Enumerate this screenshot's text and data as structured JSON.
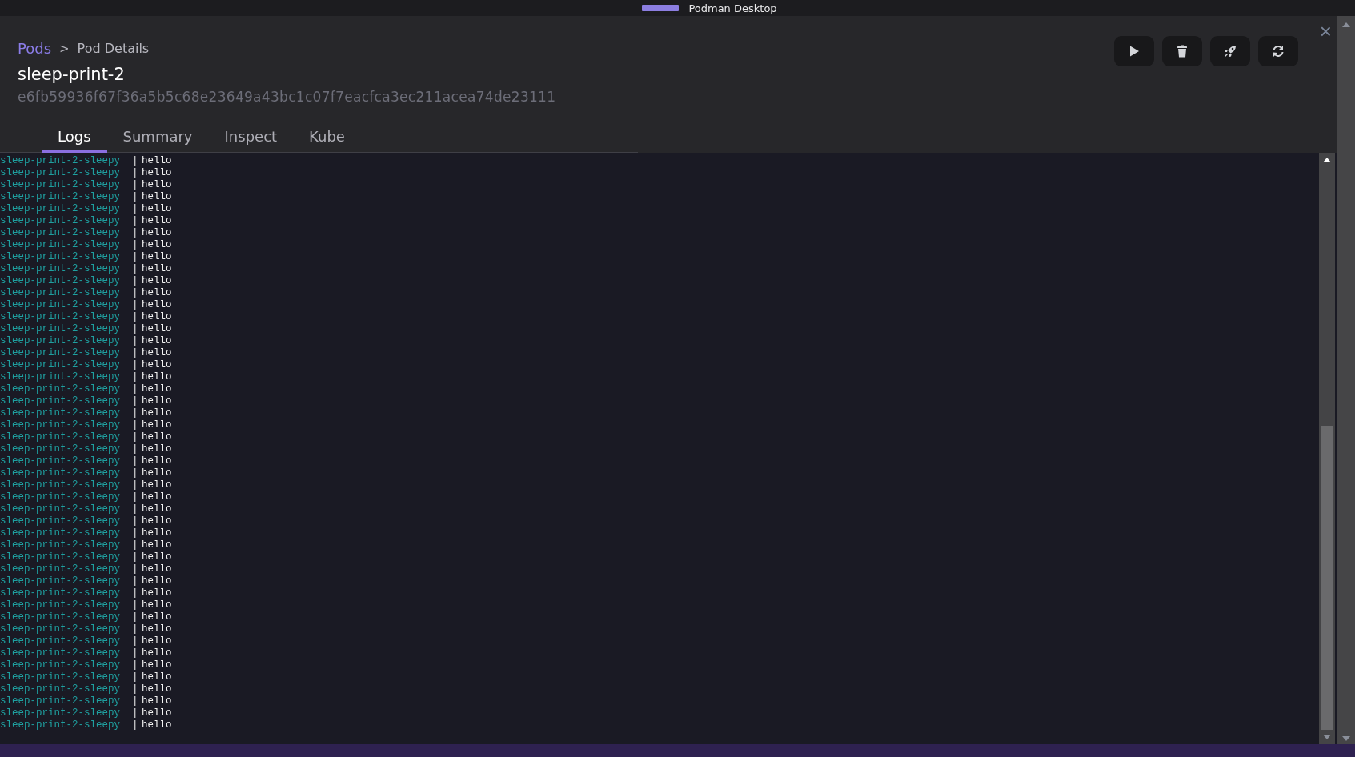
{
  "window": {
    "title": "Podman Desktop"
  },
  "breadcrumb": {
    "parent": "Pods",
    "separator": ">",
    "current": "Pod Details"
  },
  "pod": {
    "name": "sleep-print-2",
    "id": "e6fb59936f67f36a5b5c68e23649a43bc1c07f7eacfca3ec211acea74de23111"
  },
  "actions": [
    {
      "kind": "play"
    },
    {
      "kind": "delete"
    },
    {
      "kind": "deploy"
    },
    {
      "kind": "restart"
    }
  ],
  "close": "×",
  "tabs": [
    {
      "label": "Logs",
      "selected": true
    },
    {
      "label": "Summary",
      "selected": false
    },
    {
      "label": "Inspect",
      "selected": false
    },
    {
      "label": "Kube",
      "selected": false
    }
  ],
  "logs": [
    {
      "container": "sleep-print-2-sleepy",
      "separator": "|",
      "message": "hello"
    },
    {
      "container": "sleep-print-2-sleepy",
      "separator": "|",
      "message": "hello"
    },
    {
      "container": "sleep-print-2-sleepy",
      "separator": "|",
      "message": "hello"
    },
    {
      "container": "sleep-print-2-sleepy",
      "separator": "|",
      "message": "hello"
    },
    {
      "container": "sleep-print-2-sleepy",
      "separator": "|",
      "message": "hello"
    },
    {
      "container": "sleep-print-2-sleepy",
      "separator": "|",
      "message": "hello"
    },
    {
      "container": "sleep-print-2-sleepy",
      "separator": "|",
      "message": "hello"
    },
    {
      "container": "sleep-print-2-sleepy",
      "separator": "|",
      "message": "hello"
    },
    {
      "container": "sleep-print-2-sleepy",
      "separator": "|",
      "message": "hello"
    },
    {
      "container": "sleep-print-2-sleepy",
      "separator": "|",
      "message": "hello"
    },
    {
      "container": "sleep-print-2-sleepy",
      "separator": "|",
      "message": "hello"
    },
    {
      "container": "sleep-print-2-sleepy",
      "separator": "|",
      "message": "hello"
    },
    {
      "container": "sleep-print-2-sleepy",
      "separator": "|",
      "message": "hello"
    },
    {
      "container": "sleep-print-2-sleepy",
      "separator": "|",
      "message": "hello"
    },
    {
      "container": "sleep-print-2-sleepy",
      "separator": "|",
      "message": "hello"
    },
    {
      "container": "sleep-print-2-sleepy",
      "separator": "|",
      "message": "hello"
    },
    {
      "container": "sleep-print-2-sleepy",
      "separator": "|",
      "message": "hello"
    },
    {
      "container": "sleep-print-2-sleepy",
      "separator": "|",
      "message": "hello"
    },
    {
      "container": "sleep-print-2-sleepy",
      "separator": "|",
      "message": "hello"
    },
    {
      "container": "sleep-print-2-sleepy",
      "separator": "|",
      "message": "hello"
    },
    {
      "container": "sleep-print-2-sleepy",
      "separator": "|",
      "message": "hello"
    },
    {
      "container": "sleep-print-2-sleepy",
      "separator": "|",
      "message": "hello"
    },
    {
      "container": "sleep-print-2-sleepy",
      "separator": "|",
      "message": "hello"
    },
    {
      "container": "sleep-print-2-sleepy",
      "separator": "|",
      "message": "hello"
    },
    {
      "container": "sleep-print-2-sleepy",
      "separator": "|",
      "message": "hello"
    },
    {
      "container": "sleep-print-2-sleepy",
      "separator": "|",
      "message": "hello"
    },
    {
      "container": "sleep-print-2-sleepy",
      "separator": "|",
      "message": "hello"
    },
    {
      "container": "sleep-print-2-sleepy",
      "separator": "|",
      "message": "hello"
    },
    {
      "container": "sleep-print-2-sleepy",
      "separator": "|",
      "message": "hello"
    },
    {
      "container": "sleep-print-2-sleepy",
      "separator": "|",
      "message": "hello"
    },
    {
      "container": "sleep-print-2-sleepy",
      "separator": "|",
      "message": "hello"
    },
    {
      "container": "sleep-print-2-sleepy",
      "separator": "|",
      "message": "hello"
    },
    {
      "container": "sleep-print-2-sleepy",
      "separator": "|",
      "message": "hello"
    },
    {
      "container": "sleep-print-2-sleepy",
      "separator": "|",
      "message": "hello"
    },
    {
      "container": "sleep-print-2-sleepy",
      "separator": "|",
      "message": "hello"
    },
    {
      "container": "sleep-print-2-sleepy",
      "separator": "|",
      "message": "hello"
    },
    {
      "container": "sleep-print-2-sleepy",
      "separator": "|",
      "message": "hello"
    },
    {
      "container": "sleep-print-2-sleepy",
      "separator": "|",
      "message": "hello"
    },
    {
      "container": "sleep-print-2-sleepy",
      "separator": "|",
      "message": "hello"
    },
    {
      "container": "sleep-print-2-sleepy",
      "separator": "|",
      "message": "hello"
    },
    {
      "container": "sleep-print-2-sleepy",
      "separator": "|",
      "message": "hello"
    },
    {
      "container": "sleep-print-2-sleepy",
      "separator": "|",
      "message": "hello"
    },
    {
      "container": "sleep-print-2-sleepy",
      "separator": "|",
      "message": "hello"
    },
    {
      "container": "sleep-print-2-sleepy",
      "separator": "|",
      "message": "hello"
    },
    {
      "container": "sleep-print-2-sleepy",
      "separator": "|",
      "message": "hello"
    },
    {
      "container": "sleep-print-2-sleepy",
      "separator": "|",
      "message": "hello"
    },
    {
      "container": "sleep-print-2-sleepy",
      "separator": "|",
      "message": "hello"
    },
    {
      "container": "sleep-print-2-sleepy",
      "separator": "|",
      "message": "hello"
    }
  ]
}
